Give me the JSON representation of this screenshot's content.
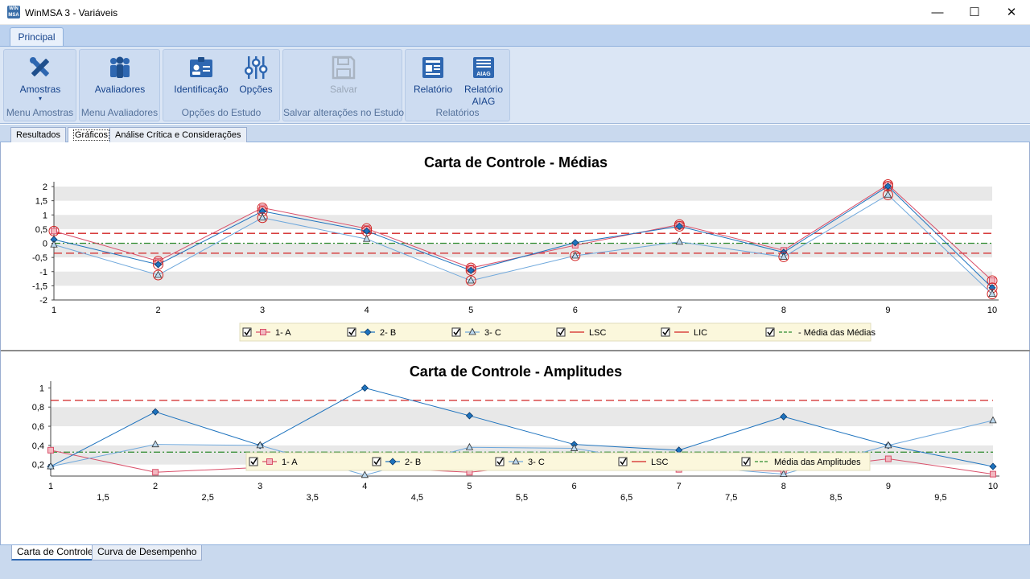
{
  "window": {
    "title": "WinMSA 3 - Variáveis",
    "app_icon_text": "WIN MSA",
    "minimize": "—",
    "maximize": "☐",
    "close": "✕"
  },
  "ribbon": {
    "tab": "Principal",
    "groups": [
      {
        "label": "Menu Amostras",
        "buttons": [
          {
            "label": "Amostras",
            "icon": "tools-icon"
          }
        ]
      },
      {
        "label": "Menu Avaliadores",
        "buttons": [
          {
            "label": "Avaliadores",
            "icon": "people-icon"
          }
        ]
      },
      {
        "label": "Opções do Estudo",
        "buttons": [
          {
            "label": "Identificação",
            "icon": "id-card-icon"
          },
          {
            "label": "Opções",
            "icon": "sliders-icon"
          }
        ]
      },
      {
        "label": "Salvar alterações no Estudo",
        "buttons": [
          {
            "label": "Salvar",
            "icon": "save-icon"
          }
        ]
      },
      {
        "label": "Relatórios",
        "buttons": [
          {
            "label": "Relatório",
            "icon": "report-icon"
          },
          {
            "label": "Relatório",
            "label2": "AIAG",
            "icon": "report-aiag-icon",
            "icon_text": "AIAG"
          }
        ]
      }
    ]
  },
  "subtabs": [
    "Resultados",
    "Gráficos",
    "Análise Crítica e Considerações"
  ],
  "bottom_tabs": [
    "Carta de Controle",
    "Curva de Desempenho"
  ],
  "colors": {
    "A": "#d9506a",
    "B": "#1e73be",
    "C": "#6fa8dc",
    "limit": "#d22323",
    "center": "#2e8b2e"
  },
  "chart_data": [
    {
      "type": "line",
      "title": "Carta de Controle - Médias",
      "x": [
        1,
        2,
        3,
        4,
        5,
        6,
        7,
        8,
        9,
        10
      ],
      "x_ticks": [
        "1",
        "2",
        "3",
        "4",
        "5",
        "6",
        "7",
        "8",
        "9",
        "10"
      ],
      "y_ticks": [
        "2",
        "1,5",
        "1",
        "0,5",
        "0",
        "-0,5",
        "-1",
        "-1,5",
        "-2"
      ],
      "ylim": [
        -2,
        2
      ],
      "series": [
        {
          "name": "1- A",
          "marker": "square",
          "values": [
            0.43,
            -0.63,
            1.25,
            0.52,
            -0.87,
            -0.07,
            0.66,
            -0.25,
            2.07,
            -1.32
          ]
        },
        {
          "name": "2- B",
          "marker": "diamond",
          "values": [
            0.13,
            -0.75,
            1.13,
            0.43,
            -0.96,
            0.02,
            0.6,
            -0.32,
            2.01,
            -1.57
          ]
        },
        {
          "name": "3- C",
          "marker": "triangle",
          "values": [
            -0.05,
            -1.12,
            0.9,
            0.15,
            -1.32,
            -0.44,
            0.05,
            -0.48,
            1.71,
            -1.79
          ]
        }
      ],
      "limits": [
        {
          "name": "LSC",
          "value": 0.35
        },
        {
          "name": "LIC",
          "value": -0.35
        }
      ],
      "center": {
        "name": " - Média das Médias",
        "value": 0
      },
      "legend": [
        "1- A",
        "2- B",
        "3- C",
        "LSC",
        "LIC",
        " - Média das Médias"
      ],
      "legend_position": "bottom"
    },
    {
      "type": "line",
      "title": "Carta de Controle - Amplitudes",
      "x": [
        1,
        2,
        3,
        4,
        5,
        6,
        7,
        8,
        9,
        10
      ],
      "x_ticks": [
        "1",
        "1,5",
        "2",
        "2,5",
        "3",
        "3,5",
        "4",
        "4,5",
        "5",
        "5,5",
        "6",
        "6,5",
        "7",
        "7,5",
        "8",
        "8,5",
        "9",
        "9,5",
        "10"
      ],
      "y_ticks": [
        "1",
        "0,8",
        "0,6",
        "0,4",
        "0,2"
      ],
      "ylim": [
        0.08,
        1.02
      ],
      "series": [
        {
          "name": "1- A",
          "marker": "square",
          "values": [
            0.35,
            0.12,
            0.17,
            0.17,
            0.12,
            0.23,
            0.15,
            0.13,
            0.26,
            0.1
          ]
        },
        {
          "name": "2- B",
          "marker": "diamond",
          "values": [
            0.18,
            0.75,
            0.4,
            1.0,
            0.71,
            0.41,
            0.35,
            0.7,
            0.4,
            0.18
          ]
        },
        {
          "name": "3- C",
          "marker": "triangle",
          "values": [
            0.18,
            0.41,
            0.4,
            0.09,
            0.38,
            0.37,
            0.19,
            0.1,
            0.4,
            0.66
          ]
        }
      ],
      "limits": [
        {
          "name": "LSC",
          "value": 0.87
        }
      ],
      "center": {
        "name": "Média das Amplitudes",
        "value": 0.33
      },
      "legend": [
        "1- A",
        "2- B",
        "3- C",
        "LSC",
        "Média das Amplitudes"
      ],
      "legend_position": "bottom"
    }
  ]
}
